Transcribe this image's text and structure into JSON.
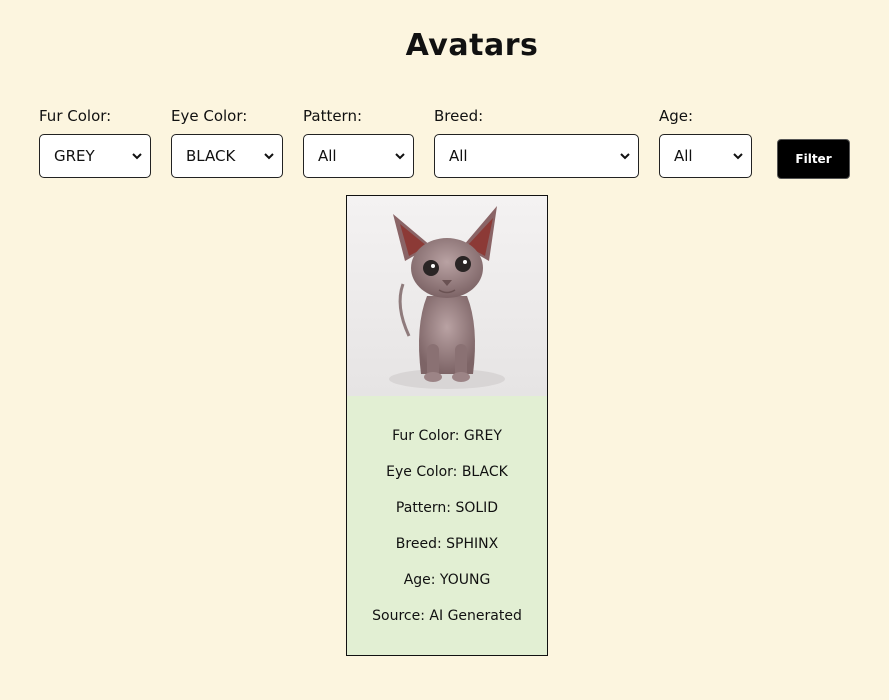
{
  "page": {
    "title": "Avatars"
  },
  "filters": [
    {
      "label": "Fur Color:",
      "value": "GREY"
    },
    {
      "label": "Eye Color:",
      "value": "BLACK"
    },
    {
      "label": "Pattern:",
      "value": "All"
    },
    {
      "label": "Breed:",
      "value": "All"
    },
    {
      "label": "Age:",
      "value": "All"
    }
  ],
  "filter_button": {
    "label": "Filter"
  },
  "card": {
    "fields": [
      "Fur Color: GREY",
      "Eye Color: BLACK",
      "Pattern: SOLID",
      "Breed: SPHINX",
      "Age: YOUNG",
      "Source: AI Generated"
    ]
  }
}
